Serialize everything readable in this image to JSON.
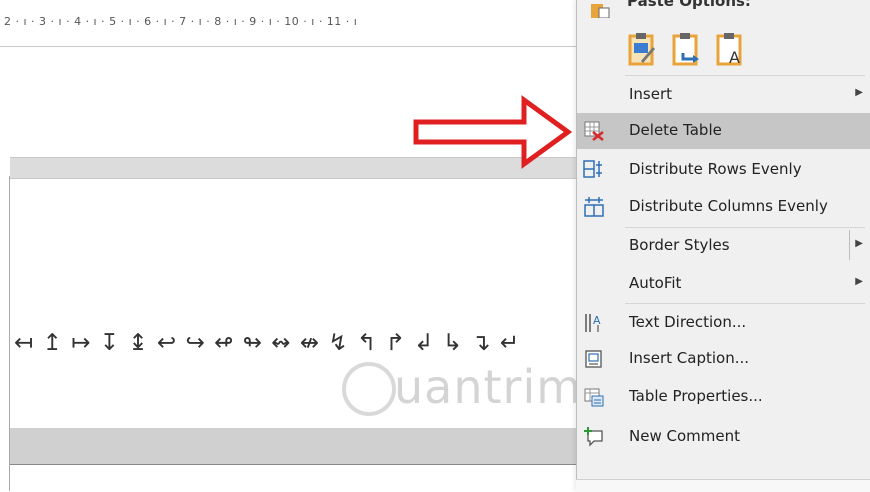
{
  "ruler": {
    "numbers": "2 · ı · 3 · ı · 4 · ı · 5 · ı · 6 · ı · 7 · ı · 8 · ı · 9 · ı · 10 · ı · 11 · ı"
  },
  "document": {
    "arrow_symbols": "↤ ↥ ↦ ↧ ↨ ↩ ↪ ↫ ↬ ↭ ↮ ↯ ↰ ↱ ↲ ↳ ↴ ↵",
    "watermark_text": "uantrimang"
  },
  "context_menu": {
    "paste_options_label": "Paste Options:",
    "paste_icons": [
      "keep-source-formatting-icon",
      "merge-formatting-icon",
      "keep-text-only-icon"
    ],
    "items": [
      {
        "label": "Insert",
        "has_submenu": true,
        "icon": ""
      },
      {
        "label": "Delete Table",
        "has_submenu": false,
        "icon": "delete-table-icon",
        "highlighted": true
      },
      {
        "label": "Distribute Rows Evenly",
        "has_submenu": false,
        "icon": "distribute-rows-icon"
      },
      {
        "label": "Distribute Columns Evenly",
        "has_submenu": false,
        "icon": "distribute-columns-icon"
      },
      {
        "label": "Border Styles",
        "has_submenu": true,
        "icon": ""
      },
      {
        "label": "AutoFit",
        "has_submenu": true,
        "icon": ""
      },
      {
        "label": "Text Direction...",
        "has_submenu": false,
        "icon": "text-direction-icon"
      },
      {
        "label": "Insert Caption...",
        "has_submenu": false,
        "icon": "insert-caption-icon"
      },
      {
        "label": "Table Properties...",
        "has_submenu": false,
        "icon": "table-properties-icon"
      },
      {
        "label": "New Comment",
        "has_submenu": false,
        "icon": "new-comment-icon"
      }
    ]
  },
  "colors": {
    "highlight": "#c6c6c6",
    "menu_bg": "#f0f0f0",
    "red_arrow": "#e02020",
    "icon_orange": "#e8a33a",
    "icon_blue": "#2f6fb5"
  }
}
